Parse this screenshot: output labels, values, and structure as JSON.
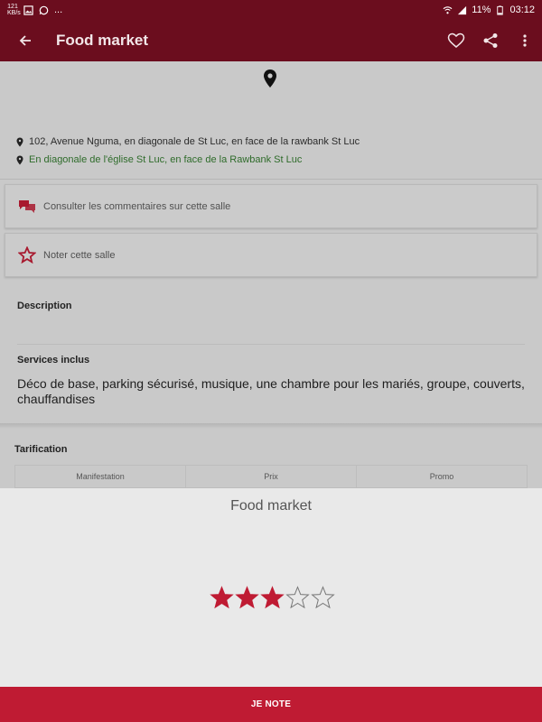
{
  "status_bar": {
    "left_badge": "121\nKB/s",
    "battery_percent": "11%",
    "time": "03:12",
    "ellipsis": "..."
  },
  "app_bar": {
    "title": "Food market"
  },
  "location": {
    "address": "102, Avenue Nguma, en diagonale de St Luc, en face de la rawbank St Luc",
    "landmark": "En diagonale de l'église St Luc, en face de la Rawbank St Luc"
  },
  "actions": {
    "comments_label": "Consulter les commentaires sur cette salle",
    "rate_label": "Noter cette salle"
  },
  "details": {
    "description_title": "Description",
    "services_title": "Services inclus",
    "services_text": "Déco de base, parking sécurisé, musique, une chambre pour les mariés, groupe, couverts, chauffandises"
  },
  "tarification": {
    "title": "Tarification",
    "columns": [
      "Manifestation",
      "Prix",
      "Promo"
    ]
  },
  "rating_sheet": {
    "title": "Food market",
    "rating": 3,
    "max_rating": 5,
    "submit_label": "JE NOTE"
  },
  "colors": {
    "app_bar": "#6b0d1e",
    "accent": "#bf1b33",
    "landmark_text": "#2e6b2a"
  }
}
